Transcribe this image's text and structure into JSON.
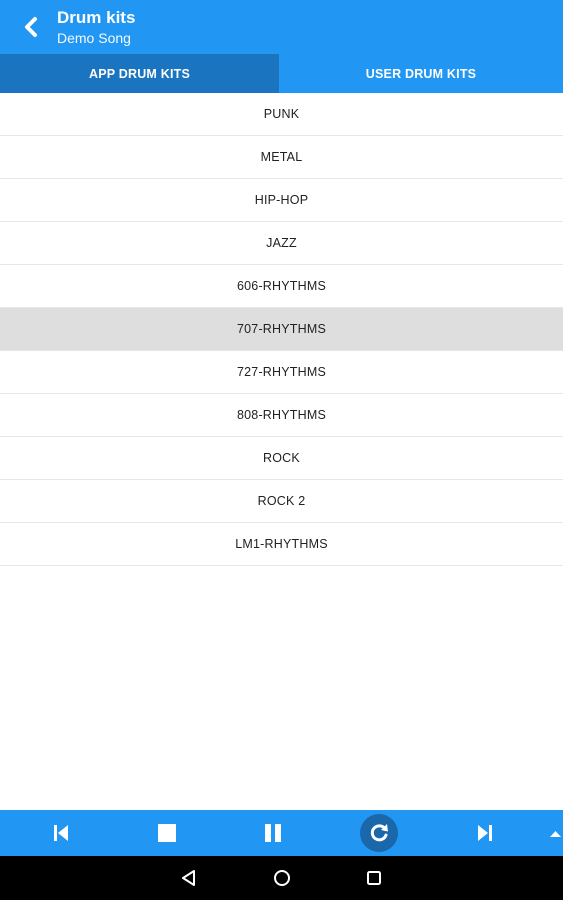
{
  "app_bar": {
    "back_icon": "chevron-left-icon",
    "title": "Drum kits",
    "subtitle": "Demo Song"
  },
  "tabs": [
    {
      "label": "APP DRUM KITS",
      "active": true
    },
    {
      "label": "USER DRUM KITS",
      "active": false
    }
  ],
  "drum_kits": {
    "items": [
      {
        "label": "PUNK"
      },
      {
        "label": "METAL"
      },
      {
        "label": "HIP-HOP"
      },
      {
        "label": "JAZZ"
      },
      {
        "label": "606-RHYTHMS"
      },
      {
        "label": "707-RHYTHMS",
        "selected": true
      },
      {
        "label": "727-RHYTHMS"
      },
      {
        "label": "808-RHYTHMS"
      },
      {
        "label": "ROCK"
      },
      {
        "label": "ROCK 2"
      },
      {
        "label": "LM1-RHYTHMS"
      }
    ]
  },
  "player": {
    "icons": [
      "skip-previous-icon",
      "stop-icon",
      "pause-icon",
      "loop-icon",
      "skip-next-icon",
      "expand-up-icon"
    ]
  },
  "system_nav": {
    "icons": [
      "back-triangle-icon",
      "home-circle-icon",
      "recents-square-icon"
    ]
  },
  "colors": {
    "primary": "#2196f3",
    "active_tab": "#1b74c0",
    "selected_row": "#dedede",
    "loop_active": "#1a67aa"
  }
}
